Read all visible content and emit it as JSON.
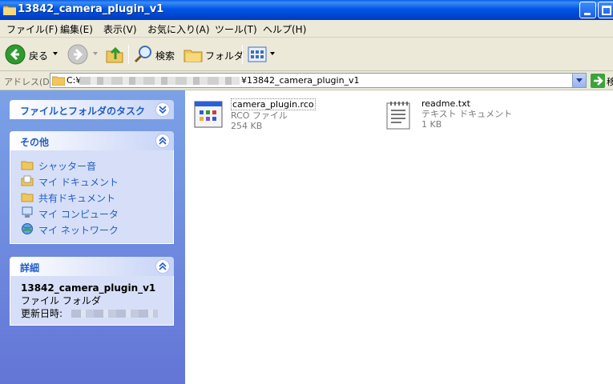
{
  "window": {
    "title": "13842_camera_plugin_v1"
  },
  "menu": [
    "ファイル(F)",
    "編集(E)",
    "表示(V)",
    "お気に入り(A)",
    "ツール(T)",
    "ヘルプ(H)"
  ],
  "toolbar": {
    "back": "戻る",
    "search": "検索",
    "folders": "フォルダ"
  },
  "address": {
    "label": "アドレス(D)",
    "drive": "C:¥",
    "path_tail": "¥13842_camera_plugin_v1",
    "go_label": "移"
  },
  "tasks": {
    "file_folder_tasks": "ファイルとフォルダのタスク",
    "other": {
      "title": "その他",
      "links": [
        "シャッター音",
        "マイ ドキュメント",
        "共有ドキュメント",
        "マイ コンピュータ",
        "マイ ネットワーク"
      ]
    },
    "details": {
      "title": "詳細",
      "name": "13842_camera_plugin_v1",
      "type": "ファイル フォルダ",
      "modified_label": "更新日時:"
    }
  },
  "files": [
    {
      "name": "camera_plugin.rco",
      "type": "RCO ファイル",
      "size": "254 KB",
      "icon": "app-file-icon"
    },
    {
      "name": "readme.txt",
      "type": "テキスト ドキュメント",
      "size": "1 KB",
      "icon": "text-document-icon"
    }
  ]
}
